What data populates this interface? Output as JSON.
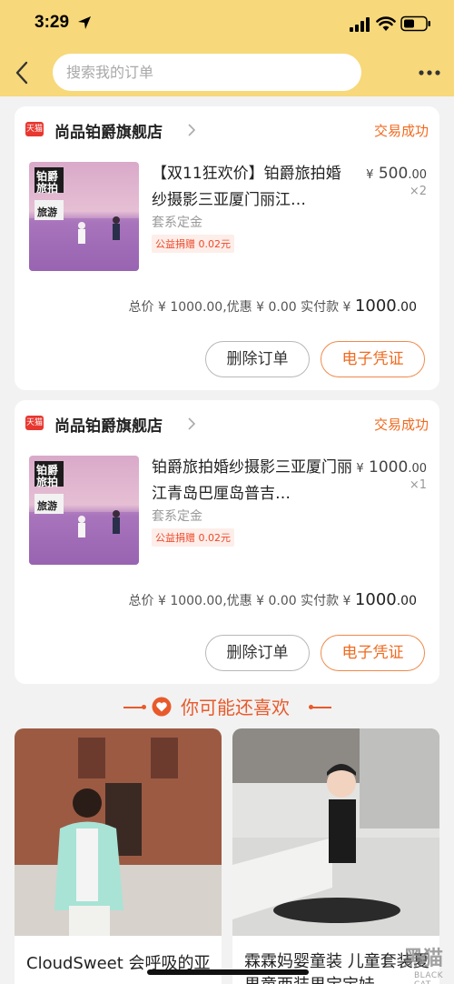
{
  "status_bar": {
    "time": "3:29"
  },
  "search": {
    "placeholder": "搜索我的订单"
  },
  "orders": [
    {
      "shop_badge": "天猫",
      "shop_name": "尚品铂爵旗舰店",
      "status": "交易成功",
      "image_text": [
        "铂爵",
        "旅拍",
        "旅游"
      ],
      "title": "【双11狂欢价】铂爵旅拍婚纱摄影三亚厦门丽江…",
      "sku": "套系定金",
      "charity": "公益捐赠 0.02元",
      "price_currency": "¥",
      "price_int": "500",
      "price_dec": ".00",
      "quantity": "×2",
      "total_label": "总价 ¥ 1000.00,优惠 ¥ 0.00  实付款 ¥",
      "paid_int": "1000",
      "paid_dec": ".00",
      "btn_delete": "删除订单",
      "btn_voucher": "电子凭证"
    },
    {
      "shop_badge": "天猫",
      "shop_name": "尚品铂爵旗舰店",
      "status": "交易成功",
      "image_text": [
        "铂爵",
        "旅拍",
        "旅游"
      ],
      "title": "铂爵旅拍婚纱摄影三亚厦门丽江青岛巴厘岛普吉…",
      "sku": "套系定金",
      "charity": "公益捐赠 0.02元",
      "price_currency": "¥",
      "price_int": "1000",
      "price_dec": ".00",
      "quantity": "×1",
      "total_label": "总价 ¥ 1000.00,优惠 ¥ 0.00  实付款 ¥",
      "paid_int": "1000",
      "paid_dec": ".00",
      "btn_delete": "删除订单",
      "btn_voucher": "电子凭证"
    }
  ],
  "recommend": {
    "title": "你可能还喜欢",
    "items": [
      {
        "name": "CloudSweet 会呼吸的亚"
      },
      {
        "name": "霖霖妈婴童装 儿童套装夏 男童西装男宝宝娃"
      }
    ]
  },
  "watermark": {
    "main": "黑猫",
    "sub": "BLACK CAT"
  },
  "colors": {
    "header_bg": "#f7d87a",
    "accent": "#f06a1f",
    "tmall_red": "#e8372f"
  }
}
